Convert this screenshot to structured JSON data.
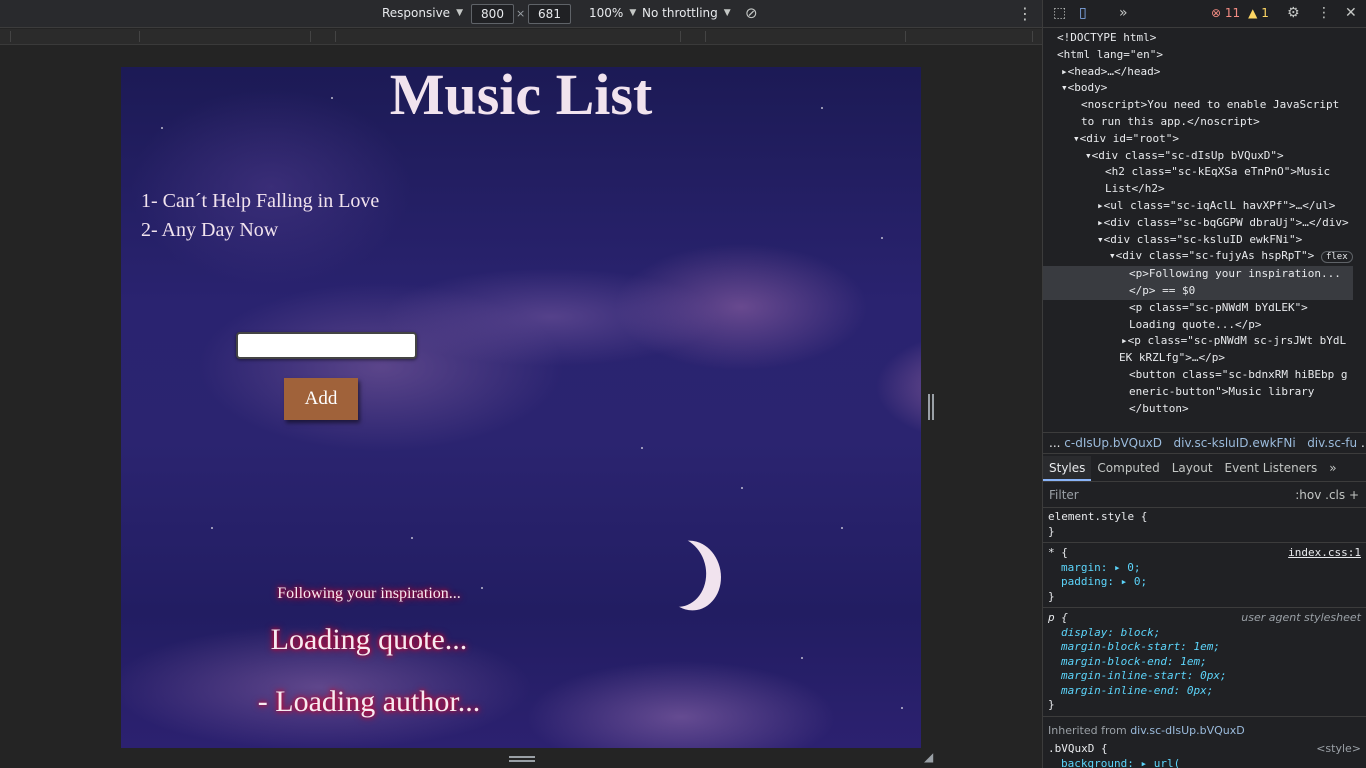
{
  "device_toolbar": {
    "device": "Responsive",
    "width": "800",
    "height": "681",
    "zoom": "100%",
    "throttling": "No throttling"
  },
  "page": {
    "title": "Music List",
    "songs": [
      "1- Can´t Help Falling in Love",
      "2- Any Day Now"
    ],
    "add_button": "Add",
    "input_value": "",
    "quote_intro": "Following your inspiration...",
    "quote_text": "Loading quote...",
    "quote_author": "- Loading author...",
    "colors": {
      "title": "#f1e3ee",
      "add_button_bg": "#a0623a",
      "quote_glow": "#d0002a"
    }
  },
  "devtools": {
    "errors": "11",
    "warnings": "1",
    "tree": [
      "<!DOCTYPE html>",
      "<html lang=\"en\">",
      "<head>…</head>",
      "<body>",
      "<noscript>You need to enable JavaScript",
      "to run this app.</noscript>",
      "<div id=\"root\">",
      "<div class=\"sc-dIsUp bVQuxD\">",
      "<h2 class=\"sc-kEqXSa eTnPnO\">Music",
      "List</h2>",
      "<ul class=\"sc-iqAclL havXPf\">…</ul>",
      "<div class=\"sc-bqGGPW dbraUj\">…</div>",
      "<div class=\"sc-ksluID ewkFNi\">",
      "<div class=\"sc-fujyAs hspRpT\">",
      "<p>Following your inspiration...",
      "</p> == $0",
      "<p class=\"sc-pNWdM bYdLEK\">",
      "Loading quote...</p>",
      "<p class=\"sc-pNWdM sc-jrsJWt bYdL",
      "EK kRZLfg\">…</p>",
      "<button class=\"sc-bdnxRM hiBEbp g",
      "eneric-button\">Music library",
      "</button>"
    ],
    "flex_badge": "flex",
    "breadcrumbs": [
      "...",
      "c-dIsUp.bVQuxD",
      "div.sc-ksluID.ewkFNi",
      "div.sc-fu",
      "..."
    ],
    "tabs": [
      "Styles",
      "Computed",
      "Layout",
      "Event Listeners",
      "»"
    ],
    "filter_placeholder": "Filter",
    "filter_tools": ":hov  .cls  +",
    "styles": {
      "element_style": "element.style {",
      "close": "}",
      "universal_selector": "* {",
      "universal_src": "index.css:1",
      "margin": "margin: ▸ 0;",
      "padding": "padding: ▸ 0;",
      "p_selector": "p {",
      "p_src": "user agent stylesheet",
      "p_props": [
        "display: block;",
        "margin-block-start: 1em;",
        "margin-block-end: 1em;",
        "margin-inline-start: 0px;",
        "margin-inline-end: 0px;"
      ],
      "inherited_label": "Inherited from",
      "inherited_from": "div.sc-dIsUp.bVQuxD",
      "last_selector": ".bVQuxD {",
      "last_src": "<style>",
      "last_prop": "background: ▸ url("
    }
  }
}
